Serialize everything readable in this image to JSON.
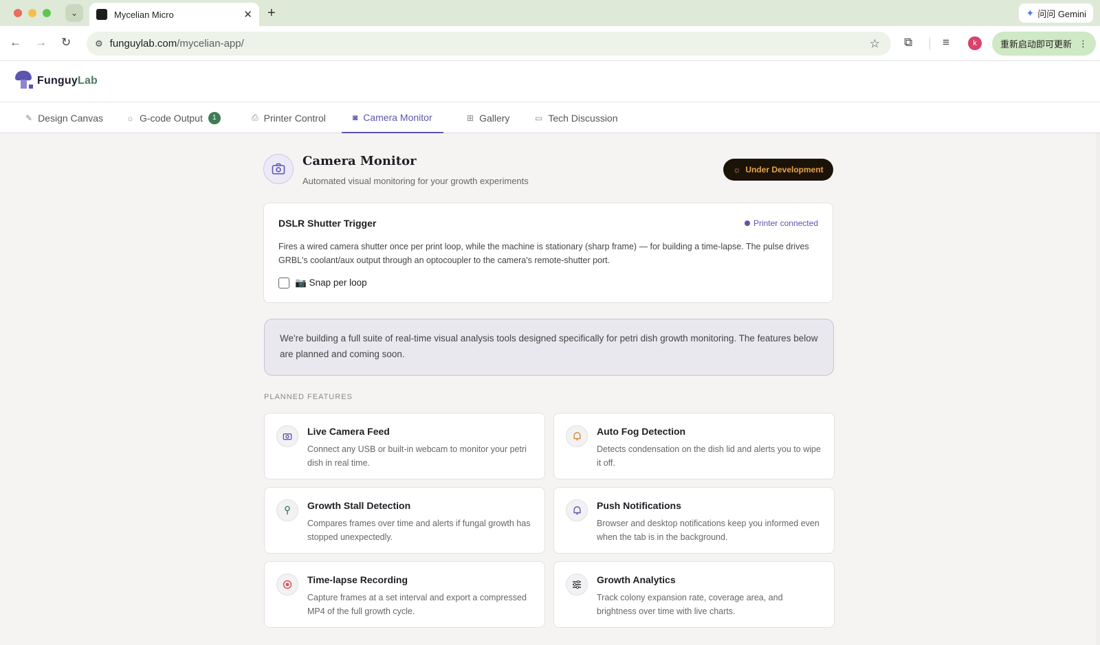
{
  "browser": {
    "tab_title": "Mycelian Micro",
    "url_host": "funguylab.com",
    "url_path": "/mycelian-app/",
    "gemini_label": "问问 Gemini",
    "update_label": "重新启动即可更新",
    "avatar_letter": "k"
  },
  "logo": {
    "name_main": "Funguy",
    "name_accent": "Lab"
  },
  "tabs": [
    {
      "label": "Design Canvas"
    },
    {
      "label": "G-code Output",
      "badge": "1"
    },
    {
      "label": "Printer Control"
    },
    {
      "label": "Camera Monitor",
      "active": true
    },
    {
      "label": "Gallery"
    },
    {
      "label": "Tech Discussion"
    }
  ],
  "page": {
    "title": "Camera Monitor",
    "subtitle": "Automated visual monitoring for your growth experiments",
    "status_badge": "Under Development"
  },
  "dslr": {
    "title": "DSLR Shutter Trigger",
    "status": "Printer connected",
    "description": "Fires a wired camera shutter once per print loop, while the machine is stationary (sharp frame) — for building a time-lapse. The pulse drives GRBL's coolant/aux output through an optocoupler to the camera's remote-shutter port.",
    "checkbox_label": "📷 Snap per loop"
  },
  "info": {
    "text": "We're building a full suite of real-time visual analysis tools designed specifically for petri dish growth monitoring. The features below are planned and coming soon."
  },
  "planned_label": "PLANNED FEATURES",
  "features": [
    {
      "title": "Live Camera Feed",
      "desc": "Connect any USB or built-in webcam to monitor your petri dish in real time.",
      "icon": "camera-icon"
    },
    {
      "title": "Auto Fog Detection",
      "desc": "Detects condensation on the dish lid and alerts you to wipe it off.",
      "icon": "bell-icon"
    },
    {
      "title": "Growth Stall Detection",
      "desc": "Compares frames over time and alerts if fungal growth has stopped unexpectedly.",
      "icon": "sprout-icon"
    },
    {
      "title": "Push Notifications",
      "desc": "Browser and desktop notifications keep you informed even when the tab is in the background.",
      "icon": "bell-icon"
    },
    {
      "title": "Time-lapse Recording",
      "desc": "Capture frames at a set interval and export a compressed MP4 of the full growth cycle.",
      "icon": "record-icon"
    },
    {
      "title": "Growth Analytics",
      "desc": "Track colony expansion rate, coverage area, and brightness over time with live charts.",
      "icon": "sliders-icon"
    }
  ],
  "colors": {
    "accent": "#5b55b0",
    "badge_green": "#3f7b55",
    "dev_badge_bg": "#1c1308",
    "dev_badge_text": "#e7a64a"
  }
}
